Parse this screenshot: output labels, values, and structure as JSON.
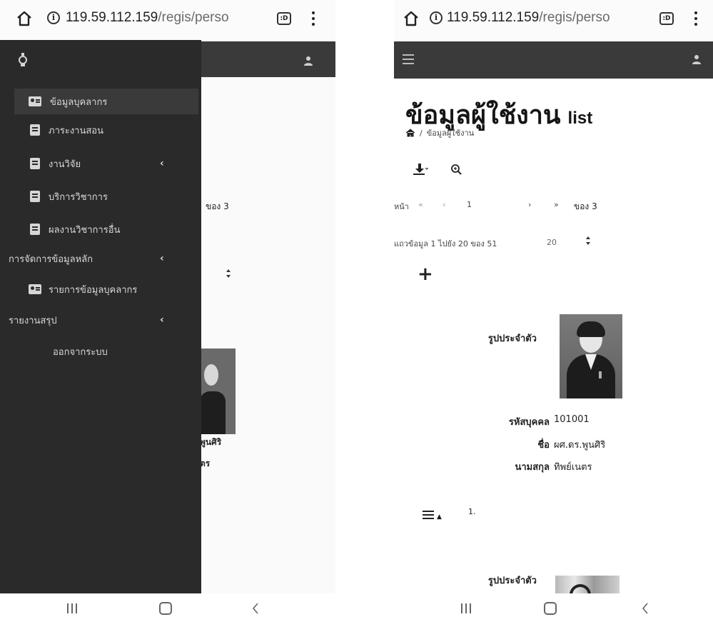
{
  "browser": {
    "host": "119.59.112.159",
    "path": "/regis/perso",
    "tab_icon_text": ":D"
  },
  "drawer": {
    "items": [
      {
        "label": "ข้อมูลบุคลากร",
        "icon": "id-card-icon",
        "active": true
      },
      {
        "label": "ภาระงานสอน",
        "icon": "book-icon"
      },
      {
        "label": "งานวิจัย",
        "icon": "book-icon",
        "chevron": "‹"
      },
      {
        "label": "บริการวิชาการ",
        "icon": "book-icon"
      },
      {
        "label": "ผลงานวิชาการอื่น",
        "icon": "book-icon"
      },
      {
        "label": "การจัดการข้อมูลหลัก",
        "chevron": "‹"
      },
      {
        "label": "รายการข้อมูลบุคลากร",
        "icon": "id-card-icon"
      },
      {
        "label": "รายงานสรุป",
        "chevron": "‹"
      },
      {
        "label": "ออกจากระบบ"
      }
    ]
  },
  "behind_drawer": {
    "page_of": "ของ 3",
    "name_fragment": "พูนศิริ",
    "surname_fragment": "ตร"
  },
  "page": {
    "title": "ข้อมูลผู้ใช้งาน",
    "title_suffix": "list",
    "breadcrumb_current": "ข้อมูลผู้ใช้งาน",
    "pager": {
      "label": "หน้า",
      "first": "«",
      "prev": "‹",
      "current": "1",
      "next": "›",
      "last": "»",
      "of_total": "ของ 3"
    },
    "rows_info": "แถวข้อมูล 1 ไปยัง 20 ของ 51",
    "page_size": "20",
    "add_symbol": "+",
    "record": {
      "photo_label": "รูปประจำตัว",
      "id_label": "รหัสบุคคล",
      "id_value": "101001",
      "name_label": "ชื่อ",
      "name_value": "ผศ.ดร.พูนศิริ",
      "surname_label": "นามสกุล",
      "surname_value": "ทิพย์เนตร"
    },
    "row_number": "1.",
    "next_record_photo_label": "รูปประจำตัว"
  }
}
